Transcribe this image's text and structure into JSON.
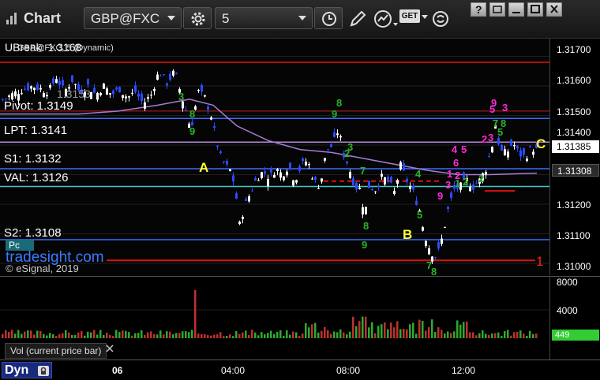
{
  "app": {
    "title": "Chart",
    "symbol": "GBP@FXC",
    "interval": "5",
    "get_label": "GET"
  },
  "price_pane": {
    "header": "UBreak: 1.3168",
    "study_label": "GBP@FXC, 5 (Dynamic)",
    "overlap_text": "1.3153",
    "levels": [
      {
        "name": "Pivot",
        "label": "Pivot: 1.3149",
        "value": 1.3149,
        "color": "#3b6cff"
      },
      {
        "name": "LPT",
        "label": "LPT: 1.3141",
        "value": 1.3141,
        "color": "#b48ad8"
      },
      {
        "name": "S1",
        "label": "S1: 1.3132",
        "value": 1.3132,
        "color": "#3b6cff"
      },
      {
        "name": "VAL",
        "label": "VAL: 1.3126",
        "value": 1.3126,
        "color": "#3fc7c7"
      },
      {
        "name": "S2",
        "label": "S2: 1.3108",
        "value": 1.3108,
        "color": "#3b6cff"
      }
    ],
    "watermark": "tradesight.com",
    "copyright": "© eSignal, 2019",
    "pc_label": "Pc",
    "markers": {
      "A": "A",
      "B": "B",
      "C": "C",
      "one": "1"
    },
    "seq_counts": [
      "3",
      "9",
      "8",
      "9",
      "8",
      "2",
      "3",
      "7",
      "8",
      "9",
      "4",
      "5",
      "7",
      "8",
      "9",
      "5",
      "3",
      "2",
      "3",
      "4",
      "5",
      "6",
      "2",
      "1",
      "3",
      "9",
      "7",
      "8",
      "5",
      "2",
      "1",
      "2"
    ],
    "last_price": "1.31385",
    "vwap_price": "1.31308"
  },
  "price_axis": {
    "ticks": [
      "1.31700",
      "1.31600",
      "1.31500",
      "1.31400",
      "1.31300",
      "1.31200",
      "1.31100",
      "1.31000"
    ]
  },
  "volume_pane": {
    "label": "Vol (current price bar)",
    "last_value": "449"
  },
  "volume_axis": {
    "ticks": [
      "8000",
      "4000"
    ]
  },
  "time_axis": {
    "ticks": [
      "06",
      "04:00",
      "08:00",
      "12:00"
    ],
    "footer": "Dyn"
  },
  "colors": {
    "up": "#ffffff",
    "down": "#2a4bff",
    "magenta": "#ff2bd6",
    "green": "#28b428",
    "red_line": "#e01010",
    "yellow": "#ffff33"
  },
  "chart_data": {
    "type": "candlestick",
    "title": "GBP@FXC, 5 (Dynamic)",
    "y_range": [
      1.3096,
      1.3176
    ],
    "x_ticks": [
      "06",
      "04:00",
      "08:00",
      "12:00"
    ],
    "price_path": [
      [
        0,
        1.3155
      ],
      [
        20,
        1.3158
      ],
      [
        40,
        1.316
      ],
      [
        60,
        1.3158
      ],
      [
        70,
        1.3163
      ],
      [
        80,
        1.3158
      ],
      [
        90,
        1.3162
      ],
      [
        100,
        1.3158
      ],
      [
        110,
        1.316
      ],
      [
        120,
        1.3157
      ],
      [
        130,
        1.316
      ],
      [
        140,
        1.3157
      ],
      [
        150,
        1.3159
      ],
      [
        160,
        1.3156
      ],
      [
        170,
        1.3158
      ],
      [
        180,
        1.3154
      ],
      [
        190,
        1.3157
      ],
      [
        200,
        1.3165
      ],
      [
        210,
        1.3161
      ],
      [
        220,
        1.3165
      ],
      [
        228,
        1.3157
      ],
      [
        236,
        1.315
      ],
      [
        240,
        1.3145
      ],
      [
        246,
        1.3153
      ],
      [
        250,
        1.3158
      ],
      [
        258,
        1.3156
      ],
      [
        266,
        1.315
      ],
      [
        272,
        1.3142
      ],
      [
        278,
        1.3136
      ],
      [
        284,
        1.3133
      ],
      [
        292,
        1.3131
      ],
      [
        298,
        1.3122
      ],
      [
        302,
        1.3113
      ],
      [
        308,
        1.3119
      ],
      [
        316,
        1.3124
      ],
      [
        324,
        1.3129
      ],
      [
        332,
        1.3131
      ],
      [
        340,
        1.3129
      ],
      [
        348,
        1.3132
      ],
      [
        356,
        1.313
      ],
      [
        364,
        1.3133
      ],
      [
        372,
        1.3128
      ],
      [
        380,
        1.3133
      ],
      [
        388,
        1.3135
      ],
      [
        396,
        1.3128
      ],
      [
        404,
        1.3126
      ],
      [
        412,
        1.3138
      ],
      [
        420,
        1.314
      ],
      [
        428,
        1.3146
      ],
      [
        432,
        1.3138
      ],
      [
        440,
        1.3133
      ],
      [
        448,
        1.3126
      ],
      [
        456,
        1.3125
      ],
      [
        460,
        1.3115
      ],
      [
        466,
        1.3126
      ],
      [
        474,
        1.3125
      ],
      [
        482,
        1.3129
      ],
      [
        490,
        1.3128
      ],
      [
        498,
        1.3124
      ],
      [
        506,
        1.3133
      ],
      [
        514,
        1.3128
      ],
      [
        522,
        1.3124
      ],
      [
        530,
        1.3118
      ],
      [
        536,
        1.311
      ],
      [
        544,
        1.3104
      ],
      [
        552,
        1.3102
      ],
      [
        558,
        1.3108
      ],
      [
        566,
        1.3118
      ],
      [
        574,
        1.3125
      ],
      [
        582,
        1.3126
      ],
      [
        590,
        1.3128
      ],
      [
        598,
        1.3126
      ],
      [
        606,
        1.3128
      ],
      [
        614,
        1.3132
      ],
      [
        622,
        1.314
      ],
      [
        626,
        1.3147
      ],
      [
        632,
        1.3138
      ],
      [
        640,
        1.3137
      ],
      [
        648,
        1.3141
      ],
      [
        656,
        1.3137
      ],
      [
        664,
        1.3136
      ],
      [
        672,
        1.3139
      ],
      [
        680,
        1.3138
      ]
    ],
    "moving_average": [
      [
        0,
        1.31505
      ],
      [
        100,
        1.31505
      ],
      [
        150,
        1.31515
      ],
      [
        200,
        1.31535
      ],
      [
        240,
        1.31555
      ],
      [
        270,
        1.31535
      ],
      [
        300,
        1.31465
      ],
      [
        340,
        1.31415
      ],
      [
        380,
        1.31385
      ],
      [
        420,
        1.31375
      ],
      [
        460,
        1.31355
      ],
      [
        500,
        1.31335
      ],
      [
        540,
        1.31315
      ],
      [
        580,
        1.313
      ],
      [
        620,
        1.313
      ],
      [
        680,
        1.31305
      ]
    ],
    "volume": {
      "axis_max": 8000,
      "spike_index": 61,
      "spike_value": 6800,
      "last": 449
    }
  }
}
